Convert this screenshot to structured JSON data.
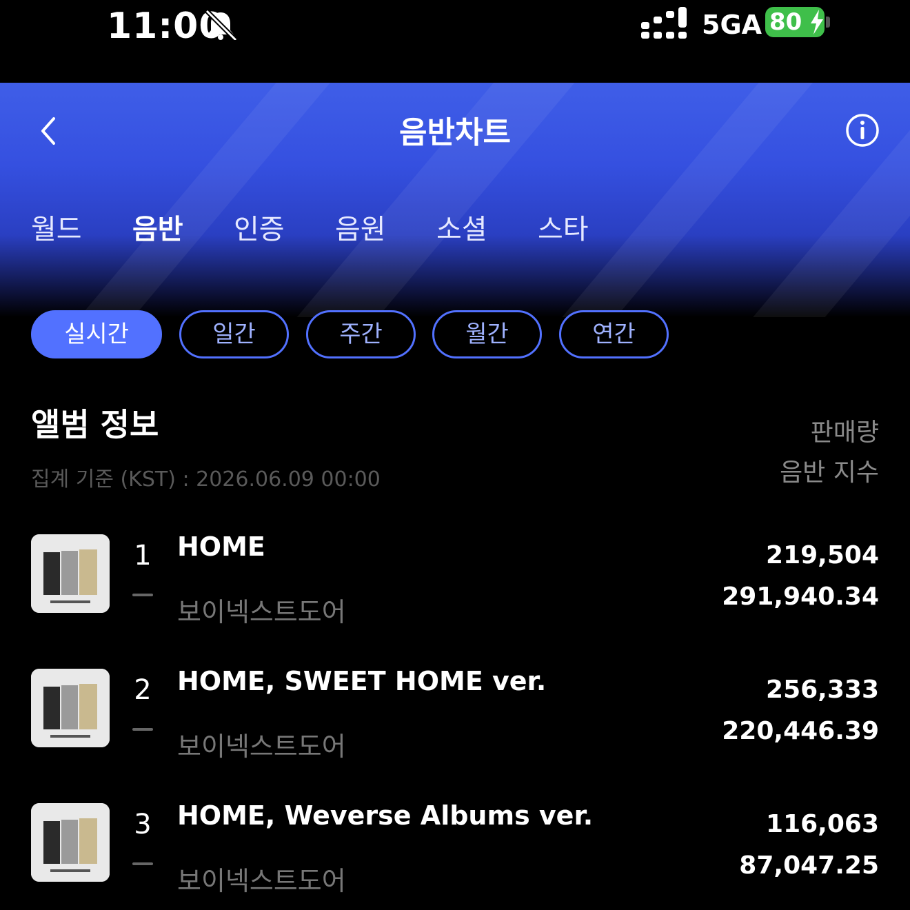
{
  "status_bar": {
    "time": "11:00",
    "network": "5GA",
    "battery": "80"
  },
  "header": {
    "title": "음반차트",
    "tabs": [
      {
        "label": "월드"
      },
      {
        "label": "음반"
      },
      {
        "label": "인증"
      },
      {
        "label": "음원"
      },
      {
        "label": "소셜"
      },
      {
        "label": "스타"
      }
    ],
    "active_tab": "음반"
  },
  "periods": [
    {
      "label": "실시간"
    },
    {
      "label": "일간"
    },
    {
      "label": "주간"
    },
    {
      "label": "월간"
    },
    {
      "label": "연간"
    }
  ],
  "active_period": "실시간",
  "section": {
    "title": "앨범 정보",
    "subtitle": "집계 기준 (KST) : 2026.06.09 00:00",
    "col_sales": "판매량",
    "col_index": "음반 지수"
  },
  "albums": [
    {
      "rank": "1",
      "title": "HOME",
      "artist": "보이넥스트도어",
      "sales": "219,504",
      "index": "291,940.34"
    },
    {
      "rank": "2",
      "title": "HOME, SWEET HOME ver.",
      "artist": "보이넥스트도어",
      "sales": "256,333",
      "index": "220,446.39"
    },
    {
      "rank": "3",
      "title": "HOME, Weverse Albums ver.",
      "artist": "보이넥스트도어",
      "sales": "116,063",
      "index": "87,047.25"
    }
  ],
  "colors": {
    "accent": "#5271ff",
    "header_blue": "#3f5ee8",
    "battery_green": "#3fbf4a"
  },
  "icons": [
    "bell-muted-icon",
    "signal-icon",
    "battery-icon",
    "back-icon",
    "info-icon"
  ]
}
